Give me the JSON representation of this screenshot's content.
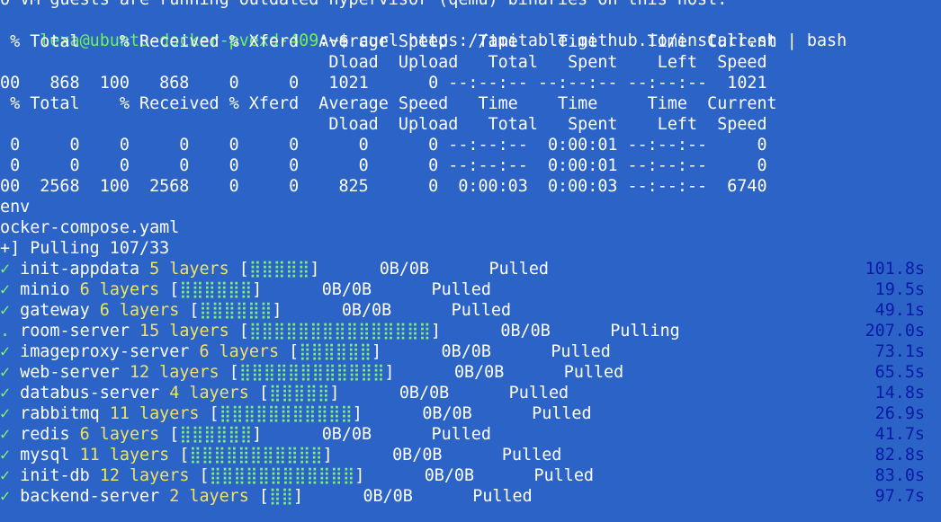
{
  "top_cut": "o VM guests are running outdated hypervisor (qemu) binaries on this host.",
  "prompt": {
    "user_host": "lexa@ubuntu-docker-pvexd-409",
    "sep": ":~$ ",
    "command": "curl https://apitable.github.io/install.sh | bash"
  },
  "curl_header_1": " % Total    % Received % Xferd  Average Speed   Time    Time     Time  Current",
  "curl_header_2": "                                 Dload  Upload   Total   Spent    Left  Speed",
  "curl_row_1": "00   868  100   868    0     0   1021      0 --:--:-- --:--:-- --:--:--  1021",
  "curl_header_3": " % Total    % Received % Xferd  Average Speed   Time    Time     Time  Current",
  "curl_header_4": "                                 Dload  Upload   Total   Spent    Left  Speed",
  "curl_row_2": " 0     0    0     0    0     0      0      0 --:--:--  0:00:01 --:--:--     0",
  "curl_row_3": " 0     0    0     0    0     0      0      0 --:--:--  0:00:01 --:--:--     0",
  "curl_row_4": "00  2568  100  2568    0     0    825      0  0:00:03  0:00:03 --:--:--  6740",
  "env_line": "env",
  "compose_line": "ocker-compose.yaml",
  "pulling_line": "+] Pulling 107/33",
  "pulls": [
    {
      "mark": "✓",
      "name": "init-appdata",
      "layers": "5 layers",
      "bar": "⣿⣿⣿⣿⣿",
      "size": "0B/0B",
      "status": "Pulled",
      "time": "101.8s"
    },
    {
      "mark": "✓",
      "name": "minio",
      "layers": "6 layers",
      "bar": "⣿⣿⣿⣿⣿⣿",
      "size": "0B/0B",
      "status": "Pulled",
      "time": "19.5s"
    },
    {
      "mark": "✓",
      "name": "gateway",
      "layers": "6 layers",
      "bar": "⣿⣿⣿⣿⣿⣿",
      "size": "0B/0B",
      "status": "Pulled",
      "time": "49.1s"
    },
    {
      "mark": ".",
      "name": "room-server",
      "layers": "15 layers",
      "bar": "⣿⣿⣿⣿⣿⣿⣿⣿⣿⣿⣿⣿⣿⣿⣿",
      "size": "0B/0B",
      "status": "Pulling",
      "time": "207.0s"
    },
    {
      "mark": "✓",
      "name": "imageproxy-server",
      "layers": "6 layers",
      "bar": "⣿⣿⣿⣿⣿⣿",
      "size": "0B/0B",
      "status": "Pulled",
      "time": "73.1s"
    },
    {
      "mark": "✓",
      "name": "web-server",
      "layers": "12 layers",
      "bar": "⣿⣿⣿⣿⣿⣿⣿⣿⣿⣿⣿⣿",
      "size": "0B/0B",
      "status": "Pulled",
      "time": "65.5s"
    },
    {
      "mark": "✓",
      "name": "databus-server",
      "layers": "4 layers",
      "bar": "⣿⣿⣿⣿⣿",
      "size": "0B/0B",
      "status": "Pulled",
      "time": "14.8s"
    },
    {
      "mark": "✓",
      "name": "rabbitmq",
      "layers": "11 layers",
      "bar": "⣿⣿⣿⣿⣿⣿⣿⣿⣿⣿⣿",
      "size": "0B/0B",
      "status": "Pulled",
      "time": "26.9s"
    },
    {
      "mark": "✓",
      "name": "redis",
      "layers": "6 layers",
      "bar": "⣿⣿⣿⣿⣿⣿",
      "size": "0B/0B",
      "status": "Pulled",
      "time": "41.7s"
    },
    {
      "mark": "✓",
      "name": "mysql",
      "layers": "11 layers",
      "bar": "⣿⣿⣿⣿⣿⣿⣿⣿⣿⣿⣿",
      "size": "0B/0B",
      "status": "Pulled",
      "time": "82.8s"
    },
    {
      "mark": "✓",
      "name": "init-db",
      "layers": "12 layers",
      "bar": "⣿⣿⣿⣿⣿⣿⣿⣿⣿⣿⣿⣿",
      "size": "0B/0B",
      "status": "Pulled",
      "time": "83.0s"
    },
    {
      "mark": "✓",
      "name": "backend-server",
      "layers": "2 layers",
      "bar": "⣿⣿",
      "size": "0B/0B",
      "status": "Pulled",
      "time": "97.7s"
    }
  ]
}
